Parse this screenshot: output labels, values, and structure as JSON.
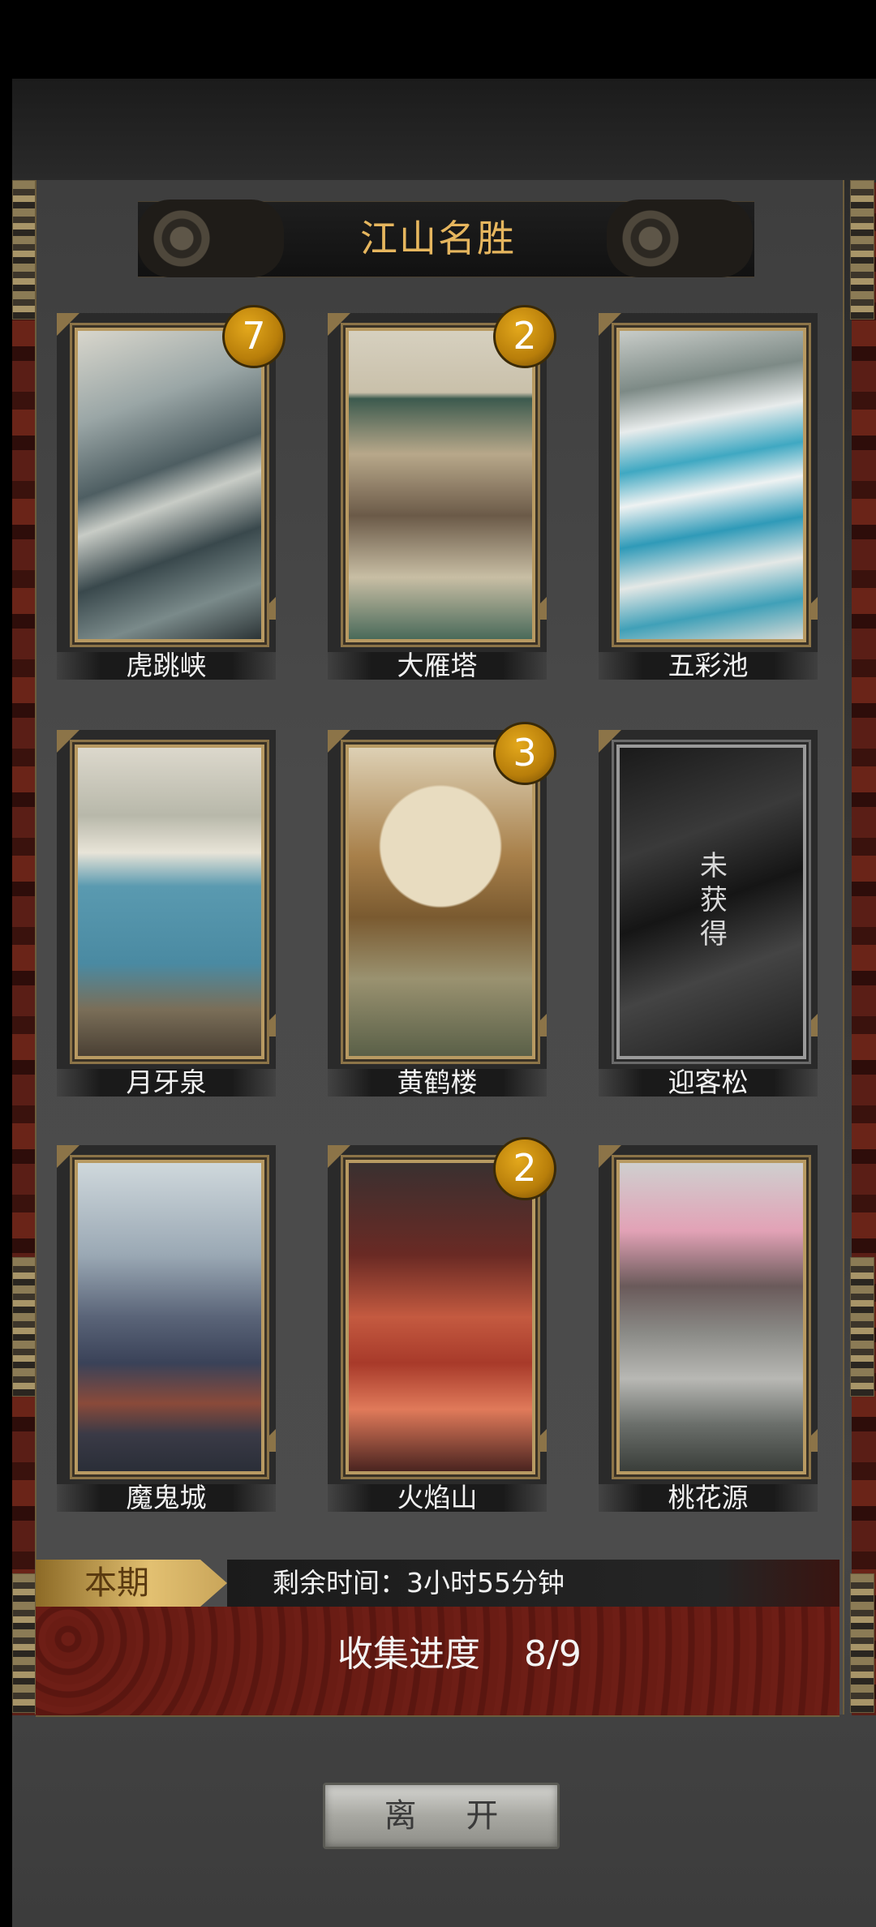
{
  "title": "江山名胜",
  "cards": [
    {
      "name": "虎跳峡",
      "badge": "7",
      "locked": false,
      "icon": "tiger-leaping-gorge-art"
    },
    {
      "name": "大雁塔",
      "badge": "2",
      "locked": false,
      "icon": "giant-wild-goose-pagoda-art"
    },
    {
      "name": "五彩池",
      "badge": "",
      "locked": false,
      "icon": "five-color-pool-art"
    },
    {
      "name": "月牙泉",
      "badge": "",
      "locked": false,
      "icon": "crescent-spring-art"
    },
    {
      "name": "黄鹤楼",
      "badge": "3",
      "locked": false,
      "icon": "yellow-crane-tower-art"
    },
    {
      "name": "迎客松",
      "badge": "",
      "locked": true,
      "locked_text": "未获得",
      "icon": "locked-card-art"
    },
    {
      "name": "魔鬼城",
      "badge": "",
      "locked": false,
      "icon": "devil-city-art"
    },
    {
      "name": "火焰山",
      "badge": "2",
      "locked": false,
      "icon": "flaming-mountains-art"
    },
    {
      "name": "桃花源",
      "badge": "",
      "locked": false,
      "icon": "peach-blossom-land-art"
    }
  ],
  "period": {
    "tag": "本期",
    "timer": "剩余时间：3小时55分钟"
  },
  "progress": {
    "label": "收集进度",
    "value": "8/9",
    "collected": 8,
    "total": 9
  },
  "leave_button": "离 开",
  "colors": {
    "accent_gold": "#e6b65e",
    "badge_gold": "#d39a12",
    "panel_red": "#6e1e16"
  }
}
